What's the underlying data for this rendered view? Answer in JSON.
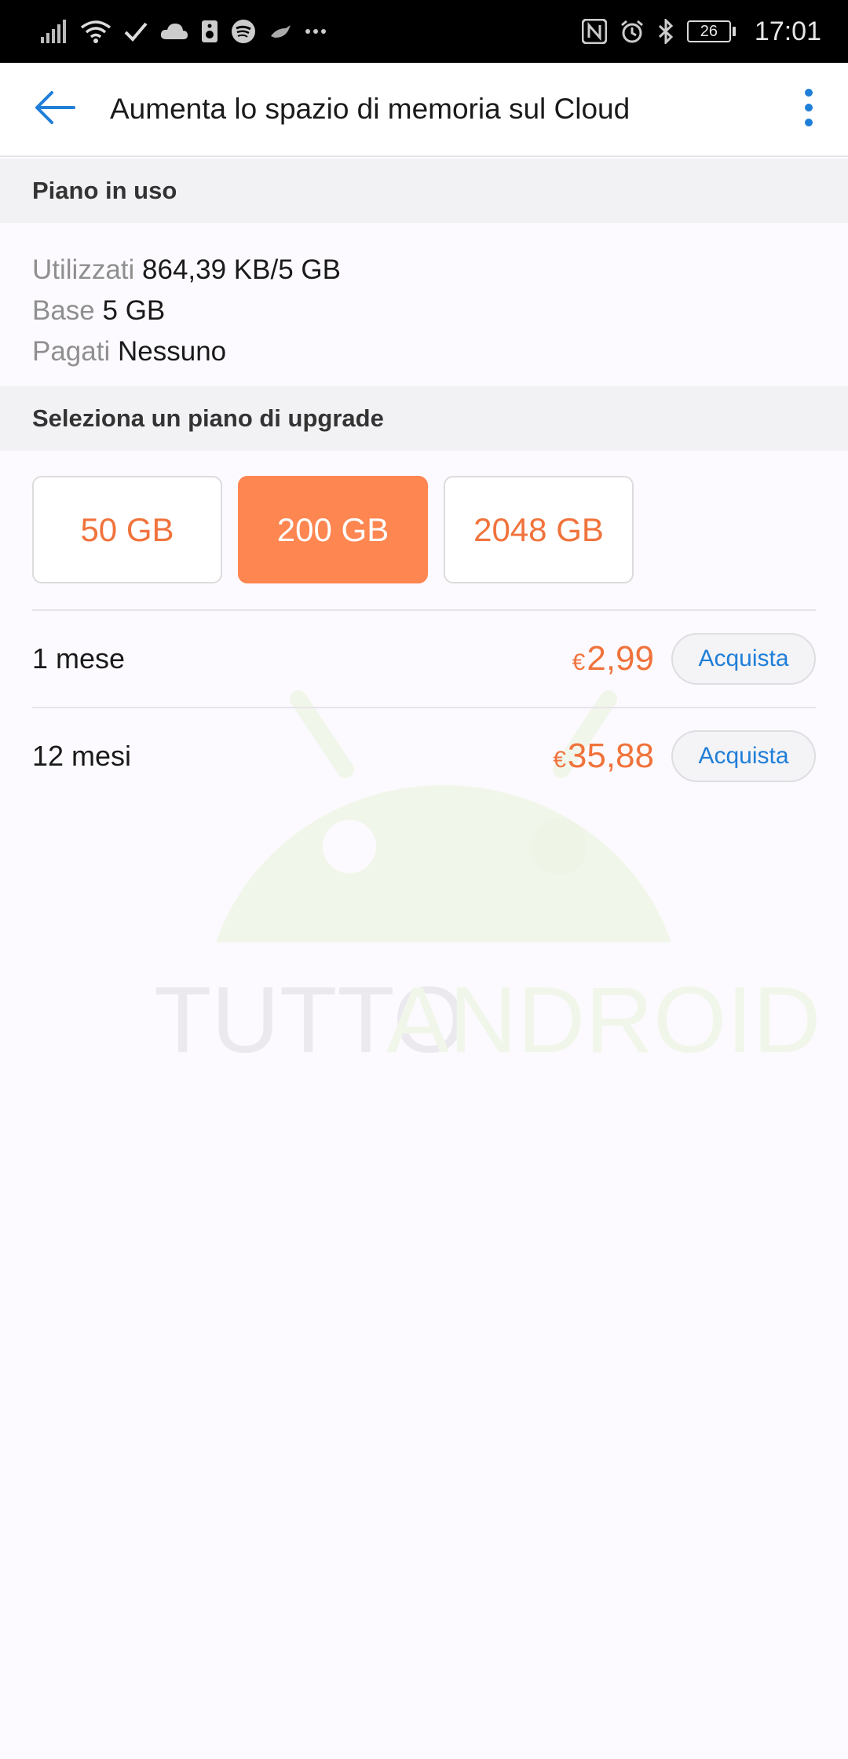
{
  "status_bar": {
    "time": "17:01",
    "battery": "26",
    "left_icons": [
      "signal-icon",
      "wifi-icon",
      "check-icon",
      "cloud-icon",
      "speaker-icon",
      "spotify-icon",
      "bird-icon",
      "more-dots-icon"
    ],
    "right_icons": [
      "nfc-icon",
      "alarm-icon",
      "bluetooth-icon",
      "battery-icon"
    ]
  },
  "app_bar": {
    "title": "Aumenta lo spazio di memoria sul Cloud",
    "back_icon": "arrow-left-icon",
    "menu_icon": "more-vertical-icon"
  },
  "current_plan": {
    "header": "Piano in uso",
    "rows": [
      {
        "key": "Utilizzati",
        "value": "864,39 KB/5 GB"
      },
      {
        "key": "Base",
        "value": "5 GB"
      },
      {
        "key": "Pagati",
        "value": "Nessuno"
      }
    ]
  },
  "upgrade": {
    "header": "Seleziona un piano di upgrade",
    "plans": [
      {
        "label": "50 GB",
        "selected": false
      },
      {
        "label": "200 GB",
        "selected": true
      },
      {
        "label": "2048 GB",
        "selected": false
      }
    ],
    "prices": [
      {
        "period": "1 mese",
        "currency": "€",
        "amount": "2,99",
        "button": "Acquista"
      },
      {
        "period": "12 mesi",
        "currency": "€",
        "amount": "35,88",
        "button": "Acquista"
      }
    ]
  },
  "watermark": {
    "text_part1": "TUTTO",
    "text_part2": "ANDROID"
  },
  "colors": {
    "accent_orange": "#fe8651",
    "price_orange": "#f0733c",
    "link_blue": "#1f7fd8"
  }
}
